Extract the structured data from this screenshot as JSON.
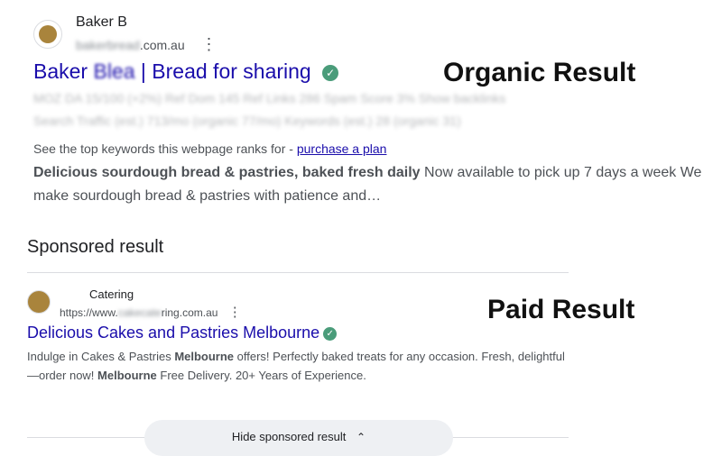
{
  "organic": {
    "site_name": "Baker B",
    "url_tail": ".com.au",
    "title_prefix": "Baker",
    "title_blurred": "Bl",
    "title_main": "| Bread for sharing",
    "metric_line_1": "MOZ DA 15/100 (+2%)   Ref Dom 145   Ref Links 286   Spam Score 3%   Show backlinks",
    "metric_line_2": "Search Traffic (est.) 713/mo (organic 77/mo)   Keywords (est.) 28 (organic 31)",
    "seo_text": "See the top keywords this webpage ranks for - ",
    "seo_link": "purchase a plan",
    "snippet_bold": "Delicious sourdough bread & pastries, baked fresh daily",
    "snippet_rest": " Now available to pick up 7 days a week We",
    "snippet_line2": "make sourdough bread & pastries with patience and…"
  },
  "labels": {
    "organic": "Organic Result",
    "paid": "Paid Result"
  },
  "sponsored": {
    "heading": "Sponsored result",
    "ad_name": "Catering",
    "ad_url_prefix": "https://www.",
    "ad_url_suffix": "ring.com.au",
    "title": "Delicious Cakes and Pastries Melbourne",
    "desc_1": "Indulge in Cakes & Pastries ",
    "desc_bold_1": "Melbourne",
    "desc_2": " offers! Perfectly baked treats for any occasion. Fresh, delightful",
    "desc_3": "—order now! ",
    "desc_bold_2": "Melbourne",
    "desc_4": " Free Delivery. 20+ Years of Experience.",
    "hide_label": "Hide sponsored result",
    "hide_icon": "chevron-up-icon"
  },
  "colors": {
    "link": "#1a0dab",
    "verified": "#4a9c7a",
    "favicon": "#a9843c"
  }
}
